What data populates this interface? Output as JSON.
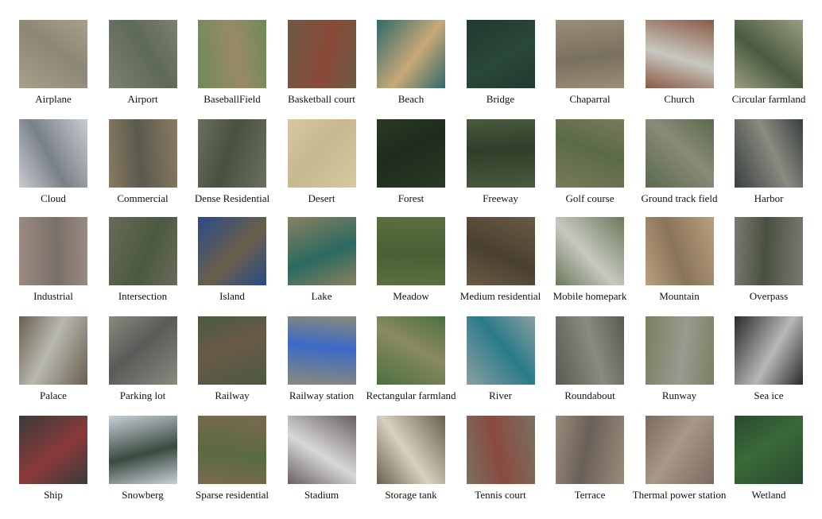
{
  "rows": [
    [
      {
        "label": "Airplane",
        "tone": "#a9a08a",
        "tone2": "#8c8675"
      },
      {
        "label": "Airport",
        "tone": "#7d8070",
        "tone2": "#5e6a55"
      },
      {
        "label": "BaseballField",
        "tone": "#6f8a55",
        "tone2": "#9a8a68"
      },
      {
        "label": "Basketball court",
        "tone": "#6d5a45",
        "tone2": "#8a4a38"
      },
      {
        "label": "Beach",
        "tone": "#2f6a6a",
        "tone2": "#c8a878"
      },
      {
        "label": "Bridge",
        "tone": "#1f3a30",
        "tone2": "#2a4838"
      },
      {
        "label": "Chaparral",
        "tone": "#9a8e78",
        "tone2": "#7a705e"
      },
      {
        "label": "Church",
        "tone": "#8a5a45",
        "tone2": "#c8c8c0"
      },
      {
        "label": "Circular farmland",
        "tone": "#9a9e80",
        "tone2": "#4a5a40"
      }
    ],
    [
      {
        "label": "Cloud",
        "tone": "#c8ccd0",
        "tone2": "#7a8088"
      },
      {
        "label": "Commercial",
        "tone": "#8a7a60",
        "tone2": "#5a5a50"
      },
      {
        "label": "Dense Residential",
        "tone": "#6a7060",
        "tone2": "#4a5040"
      },
      {
        "label": "Desert",
        "tone": "#d8c8a0",
        "tone2": "#c8b890"
      },
      {
        "label": "Forest",
        "tone": "#2a3a25",
        "tone2": "#1e2c1c"
      },
      {
        "label": "Freeway",
        "tone": "#4a5a40",
        "tone2": "#2e3e28"
      },
      {
        "label": "Golf course",
        "tone": "#7a7a5a",
        "tone2": "#5a6a48"
      },
      {
        "label": "Ground track field",
        "tone": "#5a6a50",
        "tone2": "#8a8a78"
      },
      {
        "label": "Harbor",
        "tone": "#3a4040",
        "tone2": "#8a8a80"
      }
    ],
    [
      {
        "label": "Industrial",
        "tone": "#9a8a80",
        "tone2": "#7a7068"
      },
      {
        "label": "Intersection",
        "tone": "#6a6a5a",
        "tone2": "#4a5a40"
      },
      {
        "label": "Island",
        "tone": "#2a4a8a",
        "tone2": "#6a6048"
      },
      {
        "label": "Lake",
        "tone": "#8a8060",
        "tone2": "#2a6a60"
      },
      {
        "label": "Meadow",
        "tone": "#5a7040",
        "tone2": "#4a6034"
      },
      {
        "label": "Medium residential",
        "tone": "#6a5a45",
        "tone2": "#4a4030"
      },
      {
        "label": "Mobile homepark",
        "tone": "#6a7a5a",
        "tone2": "#c8c8c0"
      },
      {
        "label": "Mountain",
        "tone": "#b8a080",
        "tone2": "#8a7458"
      },
      {
        "label": "Overpass",
        "tone": "#7a7a70",
        "tone2": "#4a5040"
      }
    ],
    [
      {
        "label": "Palace",
        "tone": "#6a6050",
        "tone2": "#b8b8b0"
      },
      {
        "label": "Parking lot",
        "tone": "#8a8a80",
        "tone2": "#5a5a58"
      },
      {
        "label": "Railway",
        "tone": "#4a5a40",
        "tone2": "#6a5a48"
      },
      {
        "label": "Railway station",
        "tone": "#8a8a7a",
        "tone2": "#3a6ac8"
      },
      {
        "label": "Rectangular farmland",
        "tone": "#4a7040",
        "tone2": "#8a8a60"
      },
      {
        "label": "River",
        "tone": "#8aa0a0",
        "tone2": "#2a7a8a"
      },
      {
        "label": "Roundabout",
        "tone": "#5a5a50",
        "tone2": "#8a8a80"
      },
      {
        "label": "Runway",
        "tone": "#7a8060",
        "tone2": "#9a9a90"
      },
      {
        "label": "Sea ice",
        "tone": "#2a2a2a",
        "tone2": "#b8b8b8"
      }
    ],
    [
      {
        "label": "Ship",
        "tone": "#3a3a3a",
        "tone2": "#8a3a3a"
      },
      {
        "label": "Snowberg",
        "tone": "#c8d0d8",
        "tone2": "#3a4a40"
      },
      {
        "label": "Sparse residential",
        "tone": "#7a6a50",
        "tone2": "#5a6a40"
      },
      {
        "label": "Stadium",
        "tone": "#6a6060",
        "tone2": "#d8d8d8"
      },
      {
        "label": "Storage tank",
        "tone": "#6a6050",
        "tone2": "#d8d0c0"
      },
      {
        "label": "Tennis court",
        "tone": "#7a7060",
        "tone2": "#8a4a40"
      },
      {
        "label": "Terrace",
        "tone": "#9a8a7a",
        "tone2": "#6a6058"
      },
      {
        "label": "Thermal power station",
        "tone": "#7a6a60",
        "tone2": "#a89888"
      },
      {
        "label": "Wetland",
        "tone": "#2a4a30",
        "tone2": "#3a6a38"
      }
    ]
  ]
}
